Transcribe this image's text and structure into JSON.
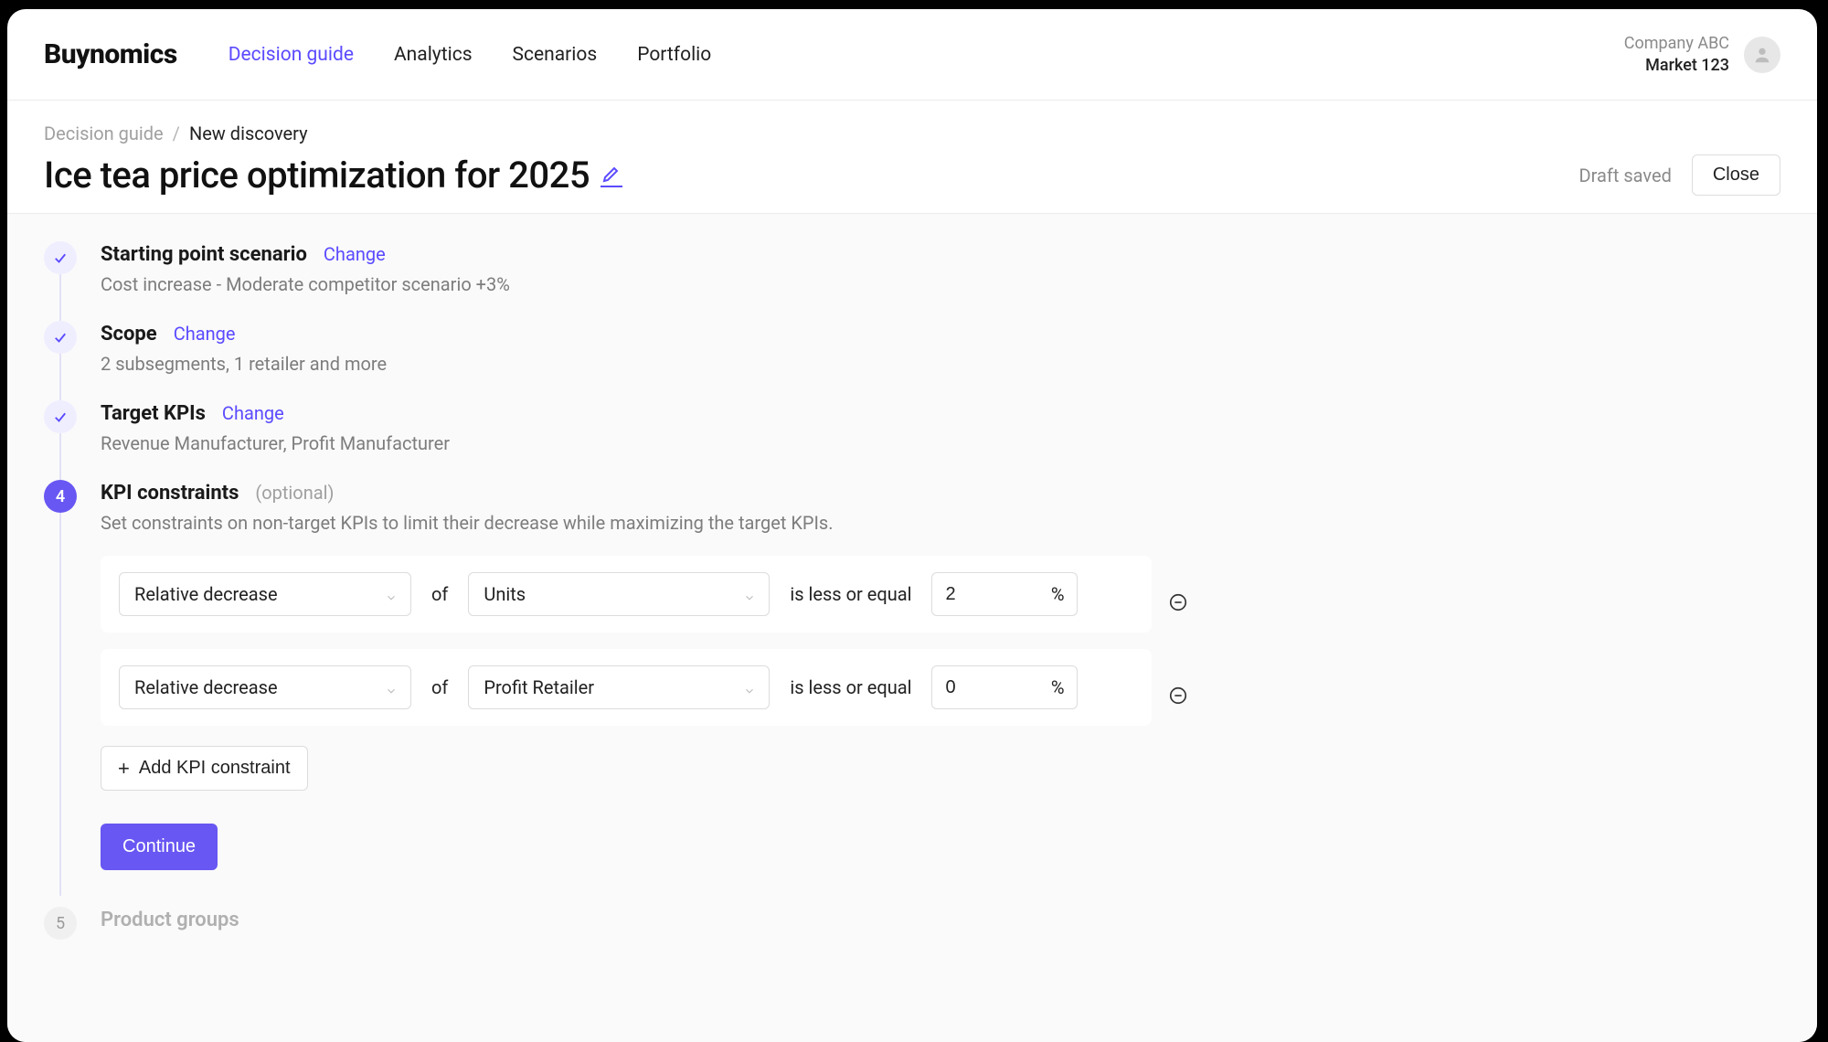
{
  "brand": "Buynomics",
  "nav": {
    "items": [
      "Decision guide",
      "Analytics",
      "Scenarios",
      "Portfolio"
    ],
    "active": 0
  },
  "account": {
    "company": "Company ABC",
    "market": "Market 123"
  },
  "breadcrumb": {
    "root": "Decision guide",
    "current": "New discovery"
  },
  "page": {
    "title": "Ice tea price optimization for 2025",
    "draft_status": "Draft saved",
    "close_label": "Close"
  },
  "steps": {
    "s1": {
      "title": "Starting point scenario",
      "change": "Change",
      "summary": "Cost increase - Moderate competitor scenario +3%"
    },
    "s2": {
      "title": "Scope",
      "change": "Change",
      "summary": "2 subsegments, 1 retailer and more"
    },
    "s3": {
      "title": "Target KPIs",
      "change": "Change",
      "summary": "Revenue Manufacturer, Profit Manufacturer"
    },
    "s4": {
      "number": "4",
      "title": "KPI constraints",
      "tag": "(optional)",
      "description": "Set constraints on non-target KPIs to limit their decrease while maximizing the target KPIs.",
      "rows": [
        {
          "metric": "Relative decrease",
          "of": "of",
          "kpi": "Units",
          "cmp": "is less or equal",
          "value": "2",
          "unit": "%"
        },
        {
          "metric": "Relative decrease",
          "of": "of",
          "kpi": "Profit Retailer",
          "cmp": "is less or equal",
          "value": "0",
          "unit": "%"
        }
      ],
      "add_label": "Add KPI constraint",
      "continue_label": "Continue"
    },
    "s5": {
      "number": "5",
      "title": "Product groups"
    }
  }
}
